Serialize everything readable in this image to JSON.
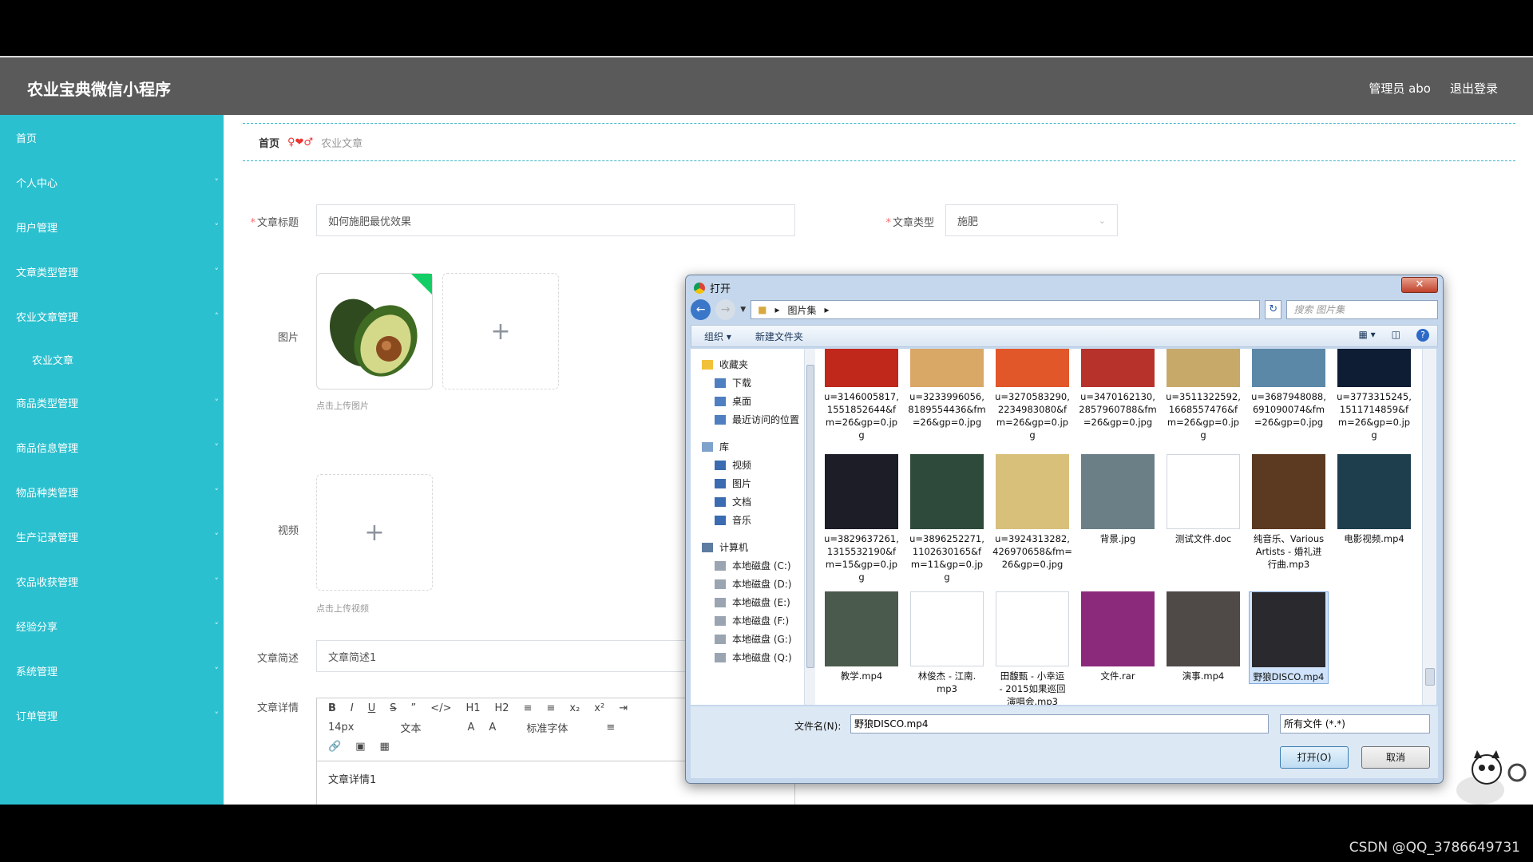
{
  "app": {
    "title": "农业宝典微信小程序",
    "admin_label": "管理员 abo",
    "logout_label": "退出登录"
  },
  "sidebar": {
    "items": [
      {
        "label": "首页",
        "chevron": false
      },
      {
        "label": "个人中心",
        "chevron": true
      },
      {
        "label": "用户管理",
        "chevron": true
      },
      {
        "label": "文章类型管理",
        "chevron": true
      },
      {
        "label": "农业文章管理",
        "chevron": true,
        "expanded": true
      },
      {
        "label": "农业文章",
        "chevron": false,
        "sub": true
      },
      {
        "label": "商品类型管理",
        "chevron": true
      },
      {
        "label": "商品信息管理",
        "chevron": true
      },
      {
        "label": "物品种类管理",
        "chevron": true
      },
      {
        "label": "生产记录管理",
        "chevron": true
      },
      {
        "label": "农品收获管理",
        "chevron": true
      },
      {
        "label": "经验分享",
        "chevron": true
      },
      {
        "label": "系统管理",
        "chevron": true
      },
      {
        "label": "订单管理",
        "chevron": true
      }
    ]
  },
  "breadcrumb": {
    "home": "首页",
    "sep": "♀❤♂",
    "current": "农业文章"
  },
  "form": {
    "title_label": "文章标题",
    "title_value": "如何施肥最优效果",
    "type_label": "文章类型",
    "type_value": "施肥",
    "image_label": "图片",
    "image_hint": "点击上传图片",
    "video_label": "视频",
    "video_hint": "点击上传视频",
    "summary_label": "文章简述",
    "summary_value": "文章简述1",
    "detail_label": "文章详情",
    "editor_font_size": "14px",
    "editor_block": "文本",
    "editor_font": "标准字体",
    "editor_content": "文章详情1"
  },
  "dialog": {
    "title": "打开",
    "path": "图片集",
    "search_placeholder": "搜索 图片集",
    "organize": "组织",
    "new_folder": "新建文件夹",
    "nav": {
      "favorites": "收藏夹",
      "fav_items": [
        "下载",
        "桌面",
        "最近访问的位置"
      ],
      "library": "库",
      "lib_items": [
        "视频",
        "图片",
        "文档",
        "音乐"
      ],
      "computer": "计算机",
      "drives": [
        "本地磁盘 (C:)",
        "本地磁盘 (D:)",
        "本地磁盘 (E:)",
        "本地磁盘 (F:)",
        "本地磁盘 (G:)",
        "本地磁盘 (Q:)"
      ]
    },
    "files": [
      {
        "name": "u=3146005817,1551852644&fm=26&gp=0.jpg",
        "lines": [
          "u=3146005817,",
          "1551852644&f",
          "m=26&gp=0.jp",
          "g"
        ],
        "color": "#c0281c"
      },
      {
        "name": "u=3233996056,8189554436&fm=26&gp=0.jpg",
        "lines": [
          "u=3233996056,",
          "8189554436&fm",
          "=26&gp=0.jpg"
        ],
        "color": "#d9a766"
      },
      {
        "name": "u=3270583290,2234983080&fm=26&gp=0.jpg",
        "lines": [
          "u=3270583290,",
          "2234983080&f",
          "m=26&gp=0.jp",
          "g"
        ],
        "color": "#e2572a"
      },
      {
        "name": "u=3470162130,2857960788&fm=26&gp=0.jpg",
        "lines": [
          "u=3470162130,",
          "2857960788&fm",
          "=26&gp=0.jpg"
        ],
        "color": "#b8322c"
      },
      {
        "name": "u=3511322592,1668557476&fm=26&gp=0.jpg",
        "lines": [
          "u=3511322592,",
          "1668557476&f",
          "m=26&gp=0.jp",
          "g"
        ],
        "color": "#c7a96a"
      },
      {
        "name": "u=3687948088,691090074&fm=26&gp=0.jpg",
        "lines": [
          "u=3687948088,",
          "691090074&fm",
          "=26&gp=0.jpg"
        ],
        "color": "#5c88a8"
      },
      {
        "name": "u=3773315245,1511714859&fm=26&gp=0.jpg",
        "lines": [
          "u=3773315245,",
          "1511714859&f",
          "m=26&gp=0.jp",
          "g"
        ],
        "color": "#0e1d34"
      },
      {
        "name": "u=3829637261,1315532190&fm=15&gp=0.jpg",
        "lines": [
          "u=3829637261,",
          "1315532190&f",
          "m=15&gp=0.jp",
          "g"
        ],
        "color": "#1d1d28"
      },
      {
        "name": "u=3896252271,1102630165&fm=11&gp=0.jpg",
        "lines": [
          "u=3896252271,",
          "1102630165&f",
          "m=11&gp=0.jp",
          "g"
        ],
        "color": "#2e4a3a"
      },
      {
        "name": "u=3924313282,426970658&fm=26&gp=0.jpg",
        "lines": [
          "u=3924313282,",
          "426970658&fm=",
          "26&gp=0.jpg"
        ],
        "color": "#d8c07a"
      },
      {
        "name": "背景.jpg",
        "lines": [
          "背景.jpg"
        ],
        "color": "#6b7f86"
      },
      {
        "name": "测试文件.doc",
        "lines": [
          "测试文件.doc"
        ],
        "color": "#ffffff"
      },
      {
        "name": "纯音乐、Various Artists - 婚礼进行曲.mp3",
        "lines": [
          "纯音乐、Various",
          "Artists - 婚礼进",
          "行曲.mp3"
        ],
        "color": "#5c3a22"
      },
      {
        "name": "电影视频.mp4",
        "lines": [
          "电影视频.mp4"
        ],
        "color": "#1e3e4e"
      },
      {
        "name": "教学.mp4",
        "lines": [
          "教学.mp4"
        ],
        "color": "#4a5a4c"
      },
      {
        "name": "林俊杰 - 江南.mp3",
        "lines": [
          "林俊杰 - 江南.",
          "mp3"
        ],
        "color": "#ffffff"
      },
      {
        "name": "田馥甄 - 小幸运 - 2015如果巡回演唱会.mp3",
        "lines": [
          "田馥甄 - 小幸运",
          "- 2015如果巡回",
          "演唱会.mp3"
        ],
        "color": "#ffffff"
      },
      {
        "name": "文件.rar",
        "lines": [
          "文件.rar"
        ],
        "color": "#8b2a7a"
      },
      {
        "name": "演事.mp4",
        "lines": [
          "演事.mp4"
        ],
        "color": "#4f4a48"
      },
      {
        "name": "野狼DISCO.mp4",
        "lines": [
          "野狼DISCO.mp4"
        ],
        "color": "#2a2a2e",
        "selected": true
      }
    ],
    "filename_label": "文件名(N):",
    "filename_value": "野狼DISCO.mp4",
    "filter_value": "所有文件 (*.*)",
    "open_label": "打开(O)",
    "cancel_label": "取消"
  },
  "watermark": "CSDN @QQ_3786649731"
}
